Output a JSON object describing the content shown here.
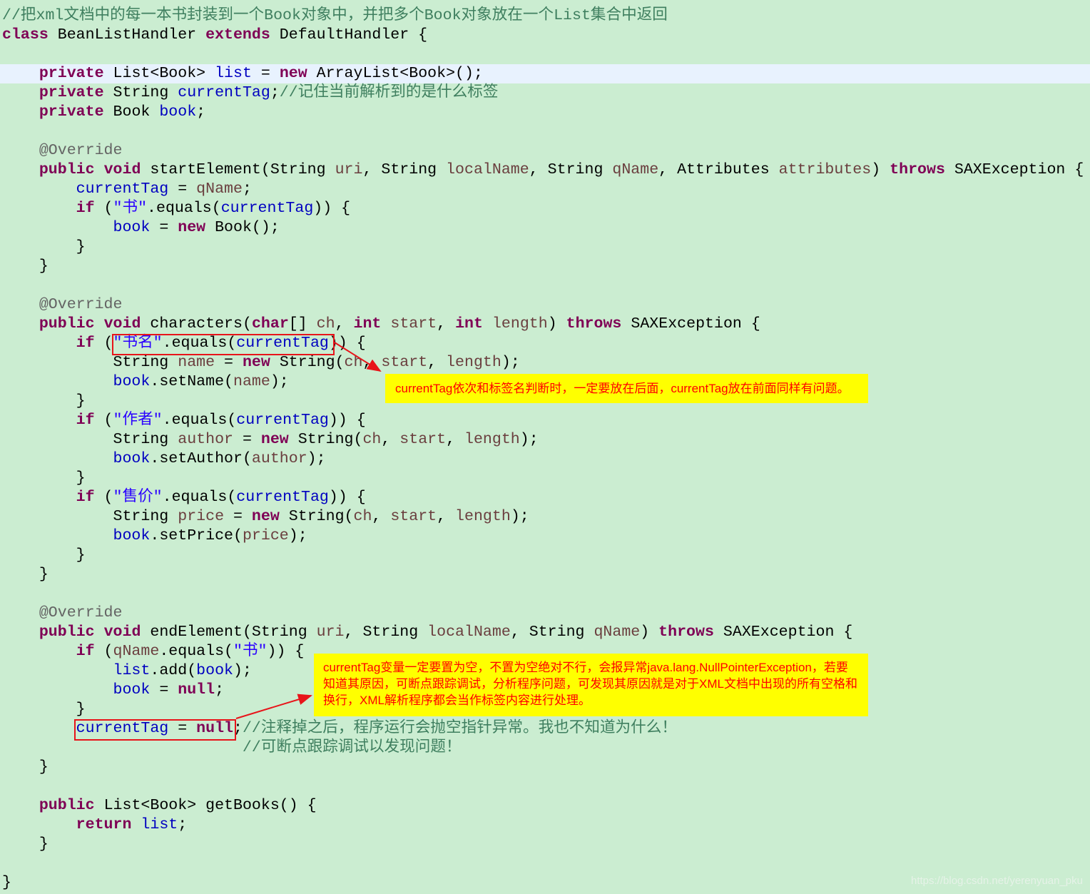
{
  "colors": {
    "background": "#cbedd1",
    "current_line": "#e8f2fe",
    "keyword": "#7f0055",
    "field": "#0000c0",
    "local": "#6a3e3e",
    "string": "#2a00ff",
    "comment": "#3f7f5f",
    "annotation": "#646464",
    "highlight_box": "#e8141a",
    "note_bg": "#ffff00",
    "note_text": "#ff0000"
  },
  "code": [
    {
      "i": 0,
      "t": [
        [
          "c",
          "//把xml文档中的每一本书封装到一个Book对象中，并把多个Book对象放在一个List集合中返回"
        ]
      ]
    },
    {
      "i": 0,
      "t": [
        [
          "k",
          "class"
        ],
        [
          "n",
          " BeanListHandler "
        ],
        [
          "k",
          "extends"
        ],
        [
          "n",
          " DefaultHandler {"
        ]
      ]
    },
    {
      "i": 0,
      "t": []
    },
    {
      "i": 1,
      "hl": true,
      "t": [
        [
          "k",
          "private"
        ],
        [
          "n",
          " List<Book> "
        ],
        [
          "f",
          "list"
        ],
        [
          "n",
          " = "
        ],
        [
          "k",
          "new"
        ],
        [
          "n",
          " ArrayList<Book>();"
        ]
      ]
    },
    {
      "i": 1,
      "t": [
        [
          "k",
          "private"
        ],
        [
          "n",
          " String "
        ],
        [
          "f",
          "currentTag"
        ],
        [
          "n",
          ";"
        ],
        [
          "c",
          "//记住当前解析到的是什么标签"
        ]
      ]
    },
    {
      "i": 1,
      "t": [
        [
          "k",
          "private"
        ],
        [
          "n",
          " Book "
        ],
        [
          "f",
          "book"
        ],
        [
          "n",
          ";"
        ]
      ]
    },
    {
      "i": 0,
      "t": []
    },
    {
      "i": 1,
      "t": [
        [
          "a",
          "@Override"
        ]
      ]
    },
    {
      "i": 1,
      "t": [
        [
          "k",
          "public"
        ],
        [
          "n",
          " "
        ],
        [
          "k",
          "void"
        ],
        [
          "n",
          " startElement(String "
        ],
        [
          "p",
          "uri"
        ],
        [
          "n",
          ", String "
        ],
        [
          "p",
          "localName"
        ],
        [
          "n",
          ", String "
        ],
        [
          "p",
          "qName"
        ],
        [
          "n",
          ", Attributes "
        ],
        [
          "p",
          "attributes"
        ],
        [
          "n",
          ") "
        ],
        [
          "k",
          "throws"
        ],
        [
          "n",
          " SAXException {"
        ]
      ]
    },
    {
      "i": 2,
      "t": [
        [
          "f",
          "currentTag"
        ],
        [
          "n",
          " = "
        ],
        [
          "p",
          "qName"
        ],
        [
          "n",
          ";"
        ]
      ]
    },
    {
      "i": 2,
      "t": [
        [
          "k",
          "if"
        ],
        [
          "n",
          " ("
        ],
        [
          "s",
          "\"书\""
        ],
        [
          "n",
          ".equals("
        ],
        [
          "f",
          "currentTag"
        ],
        [
          "n",
          ")) {"
        ]
      ]
    },
    {
      "i": 3,
      "t": [
        [
          "f",
          "book"
        ],
        [
          "n",
          " = "
        ],
        [
          "k",
          "new"
        ],
        [
          "n",
          " Book();"
        ]
      ]
    },
    {
      "i": 2,
      "t": [
        [
          "n",
          "}"
        ]
      ]
    },
    {
      "i": 1,
      "t": [
        [
          "n",
          "}"
        ]
      ]
    },
    {
      "i": 0,
      "t": []
    },
    {
      "i": 1,
      "t": [
        [
          "a",
          "@Override"
        ]
      ]
    },
    {
      "i": 1,
      "t": [
        [
          "k",
          "public"
        ],
        [
          "n",
          " "
        ],
        [
          "k",
          "void"
        ],
        [
          "n",
          " characters("
        ],
        [
          "k",
          "char"
        ],
        [
          "n",
          "[] "
        ],
        [
          "p",
          "ch"
        ],
        [
          "n",
          ", "
        ],
        [
          "k",
          "int"
        ],
        [
          "n",
          " "
        ],
        [
          "p",
          "start"
        ],
        [
          "n",
          ", "
        ],
        [
          "k",
          "int"
        ],
        [
          "n",
          " "
        ],
        [
          "p",
          "length"
        ],
        [
          "n",
          ") "
        ],
        [
          "k",
          "throws"
        ],
        [
          "n",
          " SAXException {"
        ]
      ]
    },
    {
      "i": 2,
      "t": [
        [
          "k",
          "if"
        ],
        [
          "n",
          " ("
        ],
        [
          "s",
          "\"书名\""
        ],
        [
          "n",
          ".equals("
        ],
        [
          "f",
          "currentTag"
        ],
        [
          "n",
          ")) {"
        ]
      ]
    },
    {
      "i": 3,
      "t": [
        [
          "n",
          "String "
        ],
        [
          "p",
          "name"
        ],
        [
          "n",
          " = "
        ],
        [
          "k",
          "new"
        ],
        [
          "n",
          " String("
        ],
        [
          "p",
          "ch"
        ],
        [
          "n",
          ", "
        ],
        [
          "p",
          "start"
        ],
        [
          "n",
          ", "
        ],
        [
          "p",
          "length"
        ],
        [
          "n",
          ");"
        ]
      ]
    },
    {
      "i": 3,
      "t": [
        [
          "f",
          "book"
        ],
        [
          "n",
          ".setName("
        ],
        [
          "p",
          "name"
        ],
        [
          "n",
          ");"
        ]
      ]
    },
    {
      "i": 2,
      "t": [
        [
          "n",
          "}"
        ]
      ]
    },
    {
      "i": 2,
      "t": [
        [
          "k",
          "if"
        ],
        [
          "n",
          " ("
        ],
        [
          "s",
          "\"作者\""
        ],
        [
          "n",
          ".equals("
        ],
        [
          "f",
          "currentTag"
        ],
        [
          "n",
          ")) {"
        ]
      ]
    },
    {
      "i": 3,
      "t": [
        [
          "n",
          "String "
        ],
        [
          "p",
          "author"
        ],
        [
          "n",
          " = "
        ],
        [
          "k",
          "new"
        ],
        [
          "n",
          " String("
        ],
        [
          "p",
          "ch"
        ],
        [
          "n",
          ", "
        ],
        [
          "p",
          "start"
        ],
        [
          "n",
          ", "
        ],
        [
          "p",
          "length"
        ],
        [
          "n",
          ");"
        ]
      ]
    },
    {
      "i": 3,
      "t": [
        [
          "f",
          "book"
        ],
        [
          "n",
          ".setAuthor("
        ],
        [
          "p",
          "author"
        ],
        [
          "n",
          ");"
        ]
      ]
    },
    {
      "i": 2,
      "t": [
        [
          "n",
          "}"
        ]
      ]
    },
    {
      "i": 2,
      "t": [
        [
          "k",
          "if"
        ],
        [
          "n",
          " ("
        ],
        [
          "s",
          "\"售价\""
        ],
        [
          "n",
          ".equals("
        ],
        [
          "f",
          "currentTag"
        ],
        [
          "n",
          ")) {"
        ]
      ]
    },
    {
      "i": 3,
      "t": [
        [
          "n",
          "String "
        ],
        [
          "p",
          "price"
        ],
        [
          "n",
          " = "
        ],
        [
          "k",
          "new"
        ],
        [
          "n",
          " String("
        ],
        [
          "p",
          "ch"
        ],
        [
          "n",
          ", "
        ],
        [
          "p",
          "start"
        ],
        [
          "n",
          ", "
        ],
        [
          "p",
          "length"
        ],
        [
          "n",
          ");"
        ]
      ]
    },
    {
      "i": 3,
      "t": [
        [
          "f",
          "book"
        ],
        [
          "n",
          ".setPrice("
        ],
        [
          "p",
          "price"
        ],
        [
          "n",
          ");"
        ]
      ]
    },
    {
      "i": 2,
      "t": [
        [
          "n",
          "}"
        ]
      ]
    },
    {
      "i": 1,
      "t": [
        [
          "n",
          "}"
        ]
      ]
    },
    {
      "i": 0,
      "t": []
    },
    {
      "i": 1,
      "t": [
        [
          "a",
          "@Override"
        ]
      ]
    },
    {
      "i": 1,
      "t": [
        [
          "k",
          "public"
        ],
        [
          "n",
          " "
        ],
        [
          "k",
          "void"
        ],
        [
          "n",
          " endElement(String "
        ],
        [
          "p",
          "uri"
        ],
        [
          "n",
          ", String "
        ],
        [
          "p",
          "localName"
        ],
        [
          "n",
          ", String "
        ],
        [
          "p",
          "qName"
        ],
        [
          "n",
          ") "
        ],
        [
          "k",
          "throws"
        ],
        [
          "n",
          " SAXException {"
        ]
      ]
    },
    {
      "i": 2,
      "t": [
        [
          "k",
          "if"
        ],
        [
          "n",
          " ("
        ],
        [
          "p",
          "qName"
        ],
        [
          "n",
          ".equals("
        ],
        [
          "s",
          "\"书\""
        ],
        [
          "n",
          ")) {"
        ]
      ]
    },
    {
      "i": 3,
      "t": [
        [
          "f",
          "list"
        ],
        [
          "n",
          ".add("
        ],
        [
          "f",
          "book"
        ],
        [
          "n",
          ");"
        ]
      ]
    },
    {
      "i": 3,
      "t": [
        [
          "f",
          "book"
        ],
        [
          "n",
          " = "
        ],
        [
          "k",
          "null"
        ],
        [
          "n",
          ";"
        ]
      ]
    },
    {
      "i": 2,
      "t": [
        [
          "n",
          "}"
        ]
      ]
    },
    {
      "i": 2,
      "t": [
        [
          "f",
          "currentTag"
        ],
        [
          "n",
          " = "
        ],
        [
          "k",
          "null"
        ],
        [
          "n",
          ";"
        ],
        [
          "c",
          "//注释掉之后，程序运行会抛空指针异常。我也不知道为什么！"
        ]
      ]
    },
    {
      "i": 0,
      "t": [
        [
          "n",
          "                          "
        ],
        [
          "c",
          "//可断点跟踪调试以发现问题！"
        ]
      ]
    },
    {
      "i": 1,
      "t": [
        [
          "n",
          "}"
        ]
      ]
    },
    {
      "i": 0,
      "t": []
    },
    {
      "i": 1,
      "t": [
        [
          "k",
          "public"
        ],
        [
          "n",
          " List<Book> getBooks() {"
        ]
      ]
    },
    {
      "i": 2,
      "t": [
        [
          "k",
          "return"
        ],
        [
          "n",
          " "
        ],
        [
          "f",
          "list"
        ],
        [
          "n",
          ";"
        ]
      ]
    },
    {
      "i": 1,
      "t": [
        [
          "n",
          "}"
        ]
      ]
    },
    {
      "i": 0,
      "t": []
    },
    {
      "i": 0,
      "t": [
        [
          "n",
          "}"
        ]
      ]
    }
  ],
  "notes": {
    "note1": "currentTag依次和标签名判断时，一定要放在后面，currentTag放在前面同样有问题。",
    "note2": "currentTag变量一定要置为空，不置为空绝对不行，会报异常java.lang.NullPointerException，若要知道其原因，可断点跟踪调试，分析程序问题，可发现其原因就是对于XML文档中出现的所有空格和换行，XML解析程序都会当作标签内容进行处理。"
  },
  "watermark": "https://blog.csdn.net/yerenyuan_pku"
}
